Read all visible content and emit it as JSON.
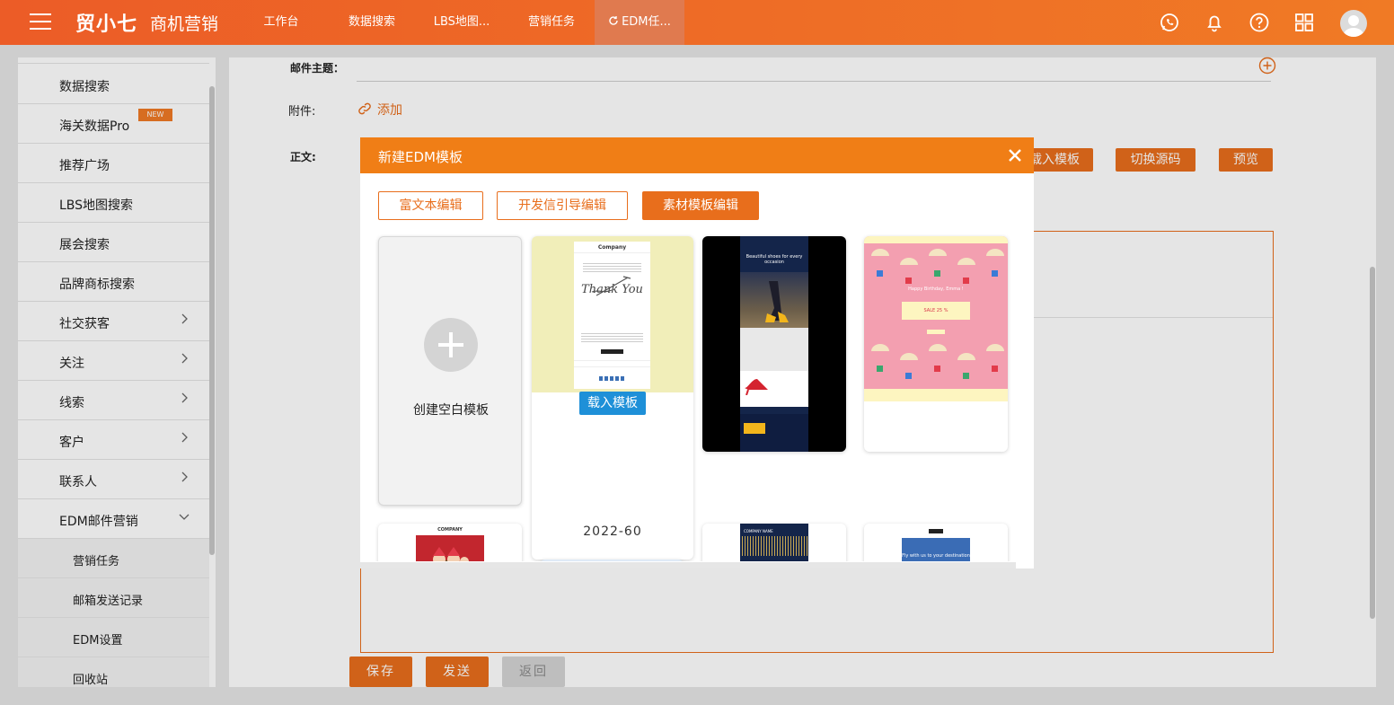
{
  "topbar": {
    "logo": "贸小七",
    "app_name": "商机营销",
    "tabs": [
      "工作台",
      "数据搜索",
      "LBS地图...",
      "营销任务",
      "EDM任..."
    ]
  },
  "sidebar": {
    "items": [
      "数据搜索",
      "海关数据Pro",
      "推荐广场",
      "LBS地图搜索",
      "展会搜索",
      "品牌商标搜索",
      "社交获客",
      "关注",
      "线索",
      "客户",
      "联系人",
      "EDM邮件营销"
    ],
    "new_badge": "NEW",
    "sub_items": [
      "营销任务",
      "邮箱发送记录",
      "EDM设置",
      "回收站"
    ]
  },
  "form": {
    "subject_label": "邮件主题：",
    "attach_label": "附件:",
    "attach_link": "添加",
    "body_label": "正文:",
    "load_template_partial": "载入模板",
    "switch_source": "切换源码",
    "preview": "预览"
  },
  "bottom": {
    "save": "保存",
    "send": "发送",
    "back": "返回"
  },
  "modal": {
    "title": "新建EDM模板",
    "modes": [
      "富文本编辑",
      "开发信引导编辑",
      "素材模板编辑"
    ],
    "blank_template": "创建空白模板",
    "load_button": "载入模板",
    "template_name": "2022-60",
    "thank_you_company": "Company",
    "thank_you_script": "Thank You",
    "heels_headline": "Beautiful shoes for every occasion",
    "birthday_text": "Happy Birthday, Emma !",
    "birthday_sale": "SALE 25 %",
    "xmas_company": "COMPANY",
    "card7_text": "COMPANY NAME",
    "card8_text": "Fly with us to your destination"
  },
  "colors": {
    "brand": "#f07a25",
    "modal_header": "#f07e16",
    "button": "#e86e1c",
    "load_button": "#1e90d8"
  }
}
